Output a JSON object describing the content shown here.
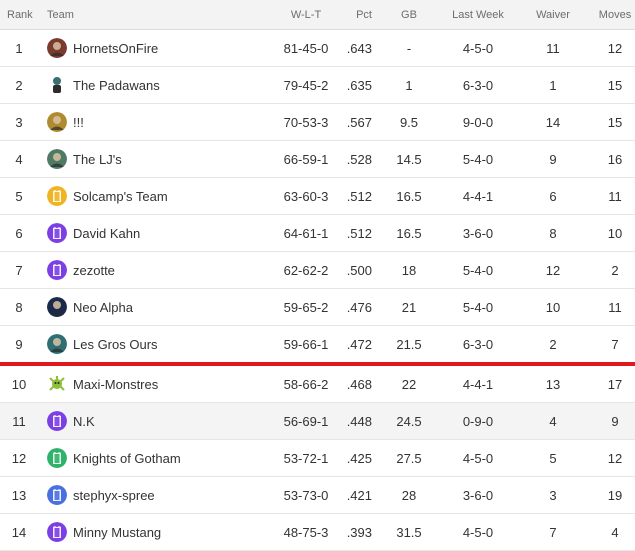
{
  "headers": {
    "rank": "Rank",
    "team": "Team",
    "wlt": "W-L-T",
    "pct": "Pct",
    "gb": "GB",
    "last_week": "Last Week",
    "waiver": "Waiver",
    "moves": "Moves"
  },
  "colors": {
    "cutline": "#e0191f",
    "header_bg": "#f3f3f3",
    "alt_row_bg": "#f4f4f4"
  },
  "rows": [
    {
      "rank": "1",
      "team": "HornetsOnFire",
      "wlt": "81-45-0",
      "pct": ".643",
      "gb": "-",
      "last_week": "4-5-0",
      "waiver": "11",
      "moves": "12",
      "avatar_icon": "photo-avatar-icon",
      "avatar_color": "#7a3b2e"
    },
    {
      "rank": "2",
      "team": "The Padawans",
      "wlt": "79-45-2",
      "pct": ".635",
      "gb": "1",
      "last_week": "6-3-0",
      "waiver": "1",
      "moves": "15",
      "avatar_icon": "character-avatar-icon",
      "avatar_color": "#3a6e73"
    },
    {
      "rank": "3",
      "team": "!!!",
      "wlt": "70-53-3",
      "pct": ".567",
      "gb": "9.5",
      "last_week": "9-0-0",
      "waiver": "14",
      "moves": "15",
      "avatar_icon": "photo-avatar-icon",
      "avatar_color": "#b08a2e"
    },
    {
      "rank": "4",
      "team": "The LJ's",
      "wlt": "66-59-1",
      "pct": ".528",
      "gb": "14.5",
      "last_week": "5-4-0",
      "waiver": "9",
      "moves": "16",
      "avatar_icon": "photo-avatar-icon",
      "avatar_color": "#4f7a63"
    },
    {
      "rank": "5",
      "team": "Solcamp's Team",
      "wlt": "63-60-3",
      "pct": ".512",
      "gb": "16.5",
      "last_week": "4-4-1",
      "waiver": "6",
      "moves": "11",
      "avatar_icon": "jersey-avatar-icon",
      "avatar_color": "#f0b323"
    },
    {
      "rank": "6",
      "team": "David Kahn",
      "wlt": "64-61-1",
      "pct": ".512",
      "gb": "16.5",
      "last_week": "3-6-0",
      "waiver": "8",
      "moves": "10",
      "avatar_icon": "jersey-avatar-icon",
      "avatar_color": "#7b3fe4"
    },
    {
      "rank": "7",
      "team": "zezotte",
      "wlt": "62-62-2",
      "pct": ".500",
      "gb": "18",
      "last_week": "5-4-0",
      "waiver": "12",
      "moves": "2",
      "avatar_icon": "jersey-avatar-icon",
      "avatar_color": "#7b3fe4"
    },
    {
      "rank": "8",
      "team": "Neo Alpha",
      "wlt": "59-65-2",
      "pct": ".476",
      "gb": "21",
      "last_week": "5-4-0",
      "waiver": "10",
      "moves": "11",
      "avatar_icon": "photo-avatar-icon",
      "avatar_color": "#1b2a4a"
    },
    {
      "rank": "9",
      "team": "Les Gros Ours",
      "wlt": "59-66-1",
      "pct": ".472",
      "gb": "21.5",
      "last_week": "6-3-0",
      "waiver": "2",
      "moves": "7",
      "avatar_icon": "photo-avatar-icon",
      "avatar_color": "#2f6f73"
    },
    {
      "rank": "10",
      "team": "Maxi-Monstres",
      "wlt": "58-66-2",
      "pct": ".468",
      "gb": "22",
      "last_week": "4-4-1",
      "waiver": "13",
      "moves": "17",
      "avatar_icon": "monster-avatar-icon",
      "avatar_color": "#8fbf3a"
    },
    {
      "rank": "11",
      "team": "N.K",
      "wlt": "56-69-1",
      "pct": ".448",
      "gb": "24.5",
      "last_week": "0-9-0",
      "waiver": "4",
      "moves": "9",
      "avatar_icon": "jersey-avatar-icon",
      "avatar_color": "#7b3fe4"
    },
    {
      "rank": "12",
      "team": "Knights of Gotham",
      "wlt": "53-72-1",
      "pct": ".425",
      "gb": "27.5",
      "last_week": "4-5-0",
      "waiver": "5",
      "moves": "12",
      "avatar_icon": "jersey-avatar-icon",
      "avatar_color": "#2fb36a"
    },
    {
      "rank": "13",
      "team": "stephyx-spree",
      "wlt": "53-73-0",
      "pct": ".421",
      "gb": "28",
      "last_week": "3-6-0",
      "waiver": "3",
      "moves": "19",
      "avatar_icon": "jersey-avatar-icon",
      "avatar_color": "#4a6fe0"
    },
    {
      "rank": "14",
      "team": "Minny Mustang",
      "wlt": "48-75-3",
      "pct": ".393",
      "gb": "31.5",
      "last_week": "4-5-0",
      "waiver": "7",
      "moves": "4",
      "avatar_icon": "jersey-avatar-icon",
      "avatar_color": "#7b3fe4"
    }
  ]
}
